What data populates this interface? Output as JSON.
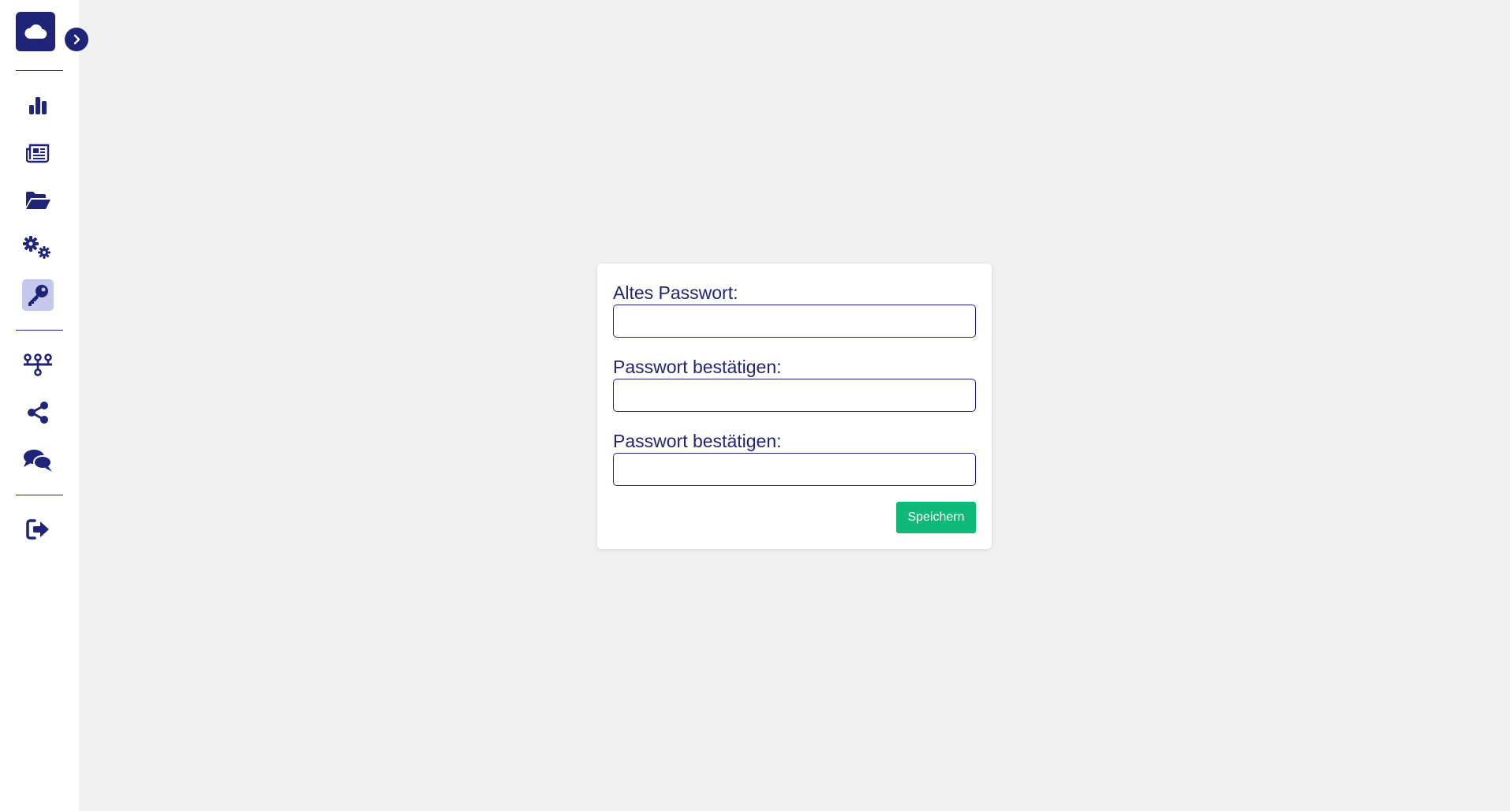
{
  "colors": {
    "primary": "#1f2478",
    "active_bg": "#c5c8ec",
    "save_button": "#0fb97a",
    "background": "#f0f0f0"
  },
  "sidebar": {
    "logo_icon": "cloud-icon",
    "toggle_icon": "chevron-right-icon",
    "items": [
      {
        "icon": "bar-chart-icon",
        "active": false
      },
      {
        "icon": "newspaper-icon",
        "active": false
      },
      {
        "icon": "folder-open-icon",
        "active": false
      },
      {
        "icon": "gears-icon",
        "active": false
      },
      {
        "icon": "key-icon",
        "active": true
      },
      {
        "icon": "network-icon",
        "active": false
      },
      {
        "icon": "share-icon",
        "active": false
      },
      {
        "icon": "comments-icon",
        "active": false
      },
      {
        "icon": "sign-out-icon",
        "active": false
      }
    ]
  },
  "form": {
    "old_password_label": "Altes Passwort:",
    "old_password_value": "",
    "confirm_password_label": "Passwort bestätigen:",
    "confirm_password_value": "",
    "confirm_password_2_label": "Passwort bestätigen:",
    "confirm_password_2_value": "",
    "save_label": "Speichern"
  }
}
